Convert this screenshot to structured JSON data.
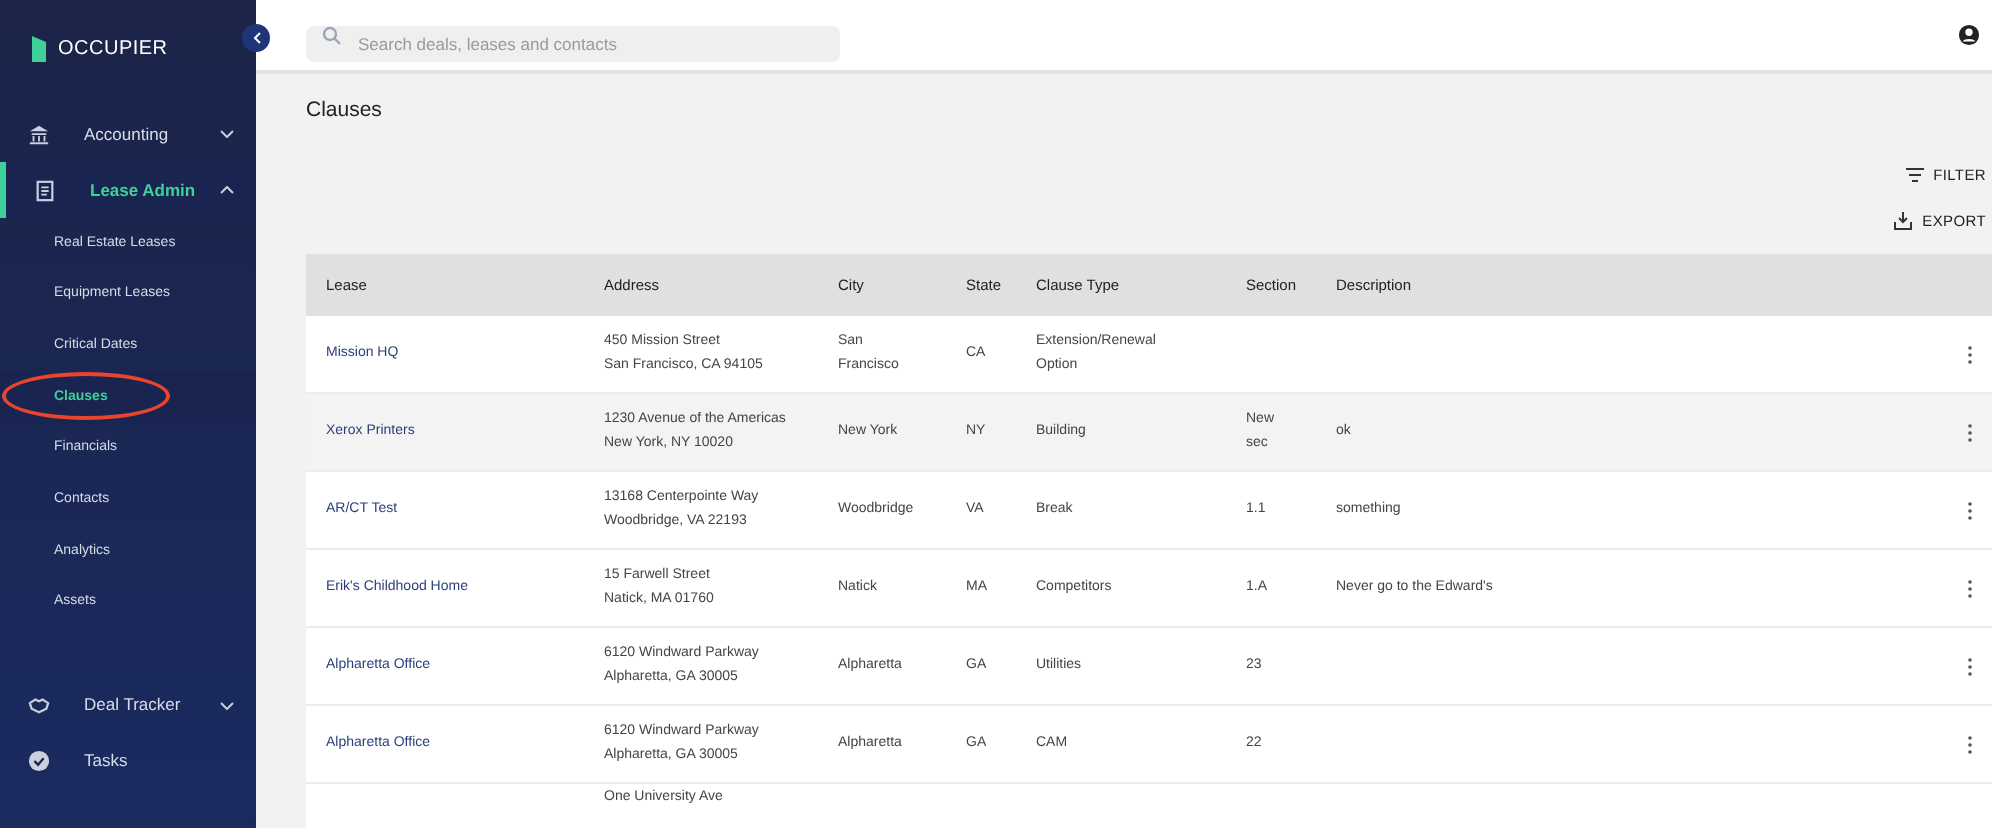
{
  "brand": "OCCUPIER",
  "search": {
    "placeholder": "Search deals, leases and contacts"
  },
  "sidebar": {
    "items": [
      {
        "kind": "group",
        "label": "Accounting",
        "expanded": false,
        "selected": false
      },
      {
        "kind": "group",
        "label": "Lease Admin",
        "expanded": true,
        "selected": true,
        "children": [
          {
            "label": "Real Estate Leases",
            "selected": false,
            "circled": false
          },
          {
            "label": "Equipment Leases",
            "selected": false,
            "circled": false
          },
          {
            "label": "Critical Dates",
            "selected": false,
            "circled": false
          },
          {
            "label": "Clauses",
            "selected": true,
            "circled": true
          },
          {
            "label": "Financials",
            "selected": false,
            "circled": false
          },
          {
            "label": "Contacts",
            "selected": false,
            "circled": false
          },
          {
            "label": "Analytics",
            "selected": false,
            "circled": false
          },
          {
            "label": "Assets",
            "selected": false,
            "circled": false
          }
        ]
      },
      {
        "kind": "group",
        "label": "Deal Tracker",
        "expanded": false,
        "selected": false
      },
      {
        "kind": "link",
        "label": "Tasks",
        "selected": false
      }
    ]
  },
  "page": {
    "title": "Clauses",
    "actions": [
      {
        "label": "FILTER"
      },
      {
        "label": "EXPORT"
      }
    ]
  },
  "table": {
    "columns": [
      "Lease",
      "Address",
      "City",
      "State",
      "Clause Type",
      "Section",
      "Description"
    ],
    "rows": [
      {
        "highlighted": false,
        "cells": [
          "Mission HQ",
          "450 Mission Street\nSan Francisco, CA 94105",
          "San\nFrancisco",
          "CA",
          "Extension/Renewal\nOption",
          "",
          ""
        ]
      },
      {
        "highlighted": true,
        "cells": [
          "Xerox Printers",
          "1230 Avenue of the Americas\nNew York, NY 10020",
          "New York",
          "NY",
          "Building",
          "New\nsec",
          "ok"
        ]
      },
      {
        "highlighted": false,
        "cells": [
          "AR/CT Test",
          "13168 Centerpointe Way\nWoodbridge, VA 22193",
          "Woodbridge",
          "VA",
          "Break",
          "1.1",
          "something"
        ]
      },
      {
        "highlighted": false,
        "cells": [
          "Erik's Childhood Home",
          "15 Farwell Street\nNatick, MA 01760",
          "Natick",
          "MA",
          "Competitors",
          "1.A",
          "Never go to the Edward's"
        ]
      },
      {
        "highlighted": false,
        "cells": [
          "Alpharetta Office",
          "6120 Windward Parkway\nAlpharetta, GA 30005",
          "Alpharetta",
          "GA",
          "Utilities",
          "23",
          ""
        ]
      },
      {
        "highlighted": false,
        "cells": [
          "Alpharetta Office",
          "6120 Windward Parkway\nAlpharetta, GA 30005",
          "Alpharetta",
          "GA",
          "CAM",
          "22",
          ""
        ]
      },
      {
        "kind": "partial",
        "cells": [
          "",
          "One University Ave",
          "",
          "",
          "",
          "",
          ""
        ]
      }
    ]
  }
}
